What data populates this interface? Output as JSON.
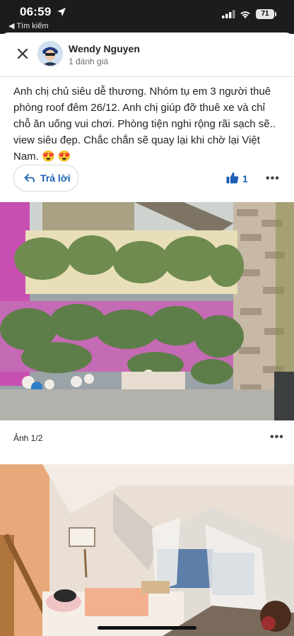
{
  "status_bar": {
    "time": "06:59",
    "back_app": "◀ Tìm kiếm",
    "battery": "71"
  },
  "header": {
    "user_name": "Wendy Nguyen",
    "review_count": "1 đánh giá"
  },
  "review": {
    "text": "Anh chị chủ siêu dễ thương. Nhóm tụ em 3 người thuê phòng roof đêm 26/12. Anh chị giúp đỡ thuê xe và chỉ chỗ ăn uống vui chơi. Phòng tiện nghi rộng rãi sạch sẽ.. view siêu đẹp. Chắc chắn sẽ quay lại khi chờ lại Việt Nam. 😍 😍"
  },
  "actions": {
    "reply_label": "Trả lời",
    "like_count": "1",
    "more": "•••"
  },
  "photos": {
    "caption": "Ảnh 1/2",
    "more": "•••"
  },
  "icons": [
    "location-arrow-icon",
    "signal-icon",
    "wifi-icon",
    "battery-icon",
    "close-icon",
    "reply-arrow-icon",
    "thumbs-up-icon",
    "more-icon"
  ],
  "colors": {
    "accent": "#1a5fb4",
    "status_bar": "#1c1c1e"
  }
}
